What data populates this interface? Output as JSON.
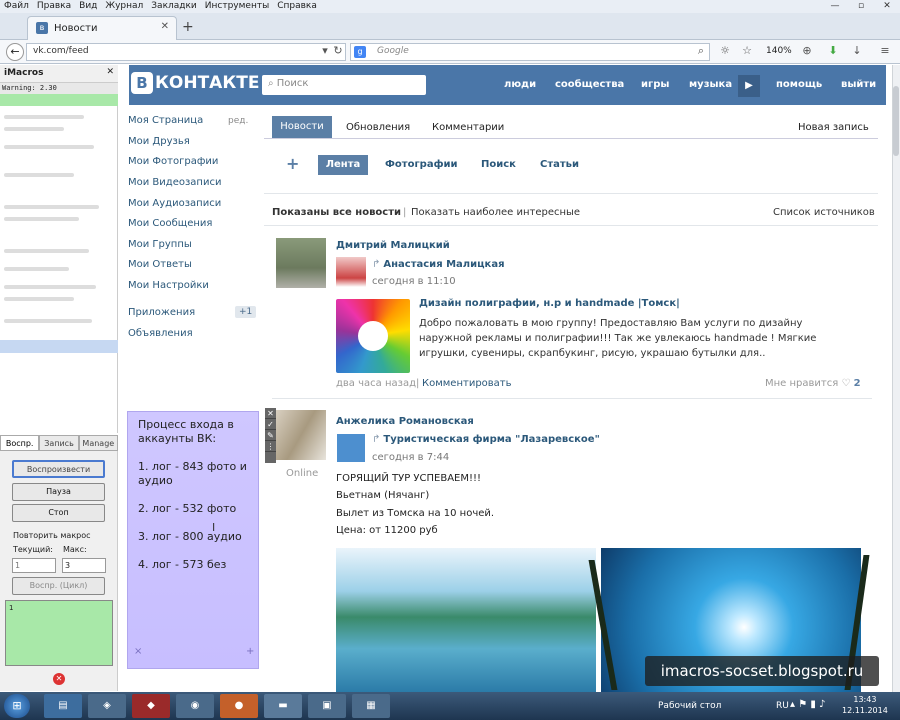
{
  "browser": {
    "menu": [
      "Файл",
      "Правка",
      "Вид",
      "Журнал",
      "Закладки",
      "Инструменты",
      "Справка"
    ],
    "window_controls": [
      "—",
      "▫",
      "✕"
    ],
    "tab_title": "Новости",
    "new_tab": "+",
    "url": "vk.com/feed",
    "search_engine": "Google",
    "search_placeholder": "Google",
    "zoom": "140%"
  },
  "imacros": {
    "title": "iMacros",
    "warning": "Warning: 2.30",
    "tabs": [
      "Воспр.",
      "Запись",
      "Manage"
    ],
    "play": "Воспроизвести",
    "pause": "Пауза",
    "stop": "Стоп",
    "repeat_label": "Повторить макрос",
    "current_label": "Текущий:",
    "max_label": "Макс:",
    "current_value": "1",
    "max_value": "3",
    "loop": "Воспр. (Цикл)",
    "log": "1"
  },
  "vk": {
    "logo_letter": "В",
    "logo": "КОНТАКТЕ",
    "search_placeholder": "Поиск",
    "nav": [
      "люди",
      "сообщества",
      "игры",
      "музыка",
      "помощь",
      "выйти"
    ],
    "left_menu": [
      "Моя Страница",
      "Мои Друзья",
      "Мои Фотографии",
      "Мои Видеозаписи",
      "Мои Аудиозаписи",
      "Мои Сообщения",
      "Мои Группы",
      "Мои Ответы",
      "Мои Настройки",
      "Приложения",
      "Объявления"
    ],
    "edit": "ред.",
    "apps_badge": "+1",
    "tabs": [
      "Новости",
      "Обновления",
      "Комментарии"
    ],
    "new_post": "Новая запись",
    "subnav": [
      "Лента",
      "Фотографии",
      "Поиск",
      "Статьи"
    ],
    "shown_all": "Показаны все новости",
    "separator": "|",
    "show_interesting": "Показать наиболее интересные",
    "sources": "Список источников",
    "post1": {
      "author": "Дмитрий Малицкий",
      "shared_from": "Анастасия Малицкая",
      "time": "сегодня в 11:10",
      "group_title": "Дизайн полиграфии, н.р и handmade |Томск|",
      "group_desc": "Добро пожаловать в мою группу! Предоставляю Вам услуги по дизайну наружной рекламы и полиграфии!!! Так же увлекаюсь handmade ! Мягкие игрушки, сувениры, скрапбукинг, рисую, украшаю бутылки для..",
      "ago": "два часа назад",
      "comment": "Комментировать",
      "like_label": "Мне нравится",
      "like_count": "2"
    },
    "post2": {
      "author": "Анжелика Романовская",
      "online": "Online",
      "shared_from": "Туристическая фирма \"Лазаревское\"",
      "time": "сегодня в 7:44",
      "lines": [
        "ГОРЯЩИЙ ТУР УСПЕВАЕМ!!!",
        "Вьетнам (Нячанг)",
        "Вылет из Томска на 10 ночей.",
        "Цена: от 11200 руб"
      ]
    }
  },
  "note": {
    "title": "Процесс входа в аккаунты ВК:",
    "items": [
      "1. лог - 843 фото и аудио",
      "2. лог - 532 фото",
      "3. лог - 800 аудио",
      "4. лог - 573 без"
    ],
    "plus": "+",
    "close": "×"
  },
  "watermark": "imacros-socset.blogspot.ru",
  "taskbar": {
    "desktop": "Рабочий стол",
    "lang": "RU",
    "time": "13:43",
    "date": "12.11.2014"
  }
}
